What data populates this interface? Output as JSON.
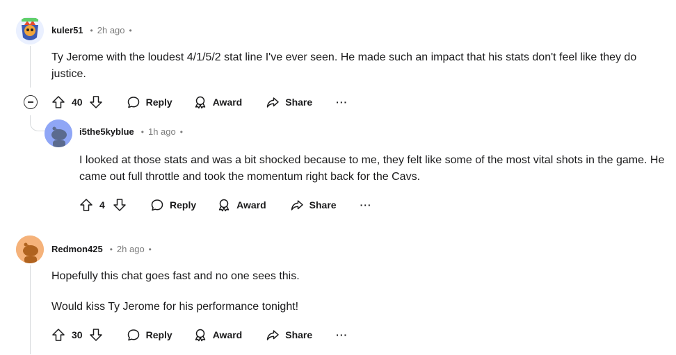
{
  "comments": [
    {
      "author": "kuler51",
      "time": "2h ago",
      "body": [
        "Ty Jerome with the loudest 4/1/5/2 stat line I've ever seen. He made such an impact that his stats don't feel like they do justice."
      ],
      "votes": "40",
      "avatar_badge": "Finish-a-robot"
    },
    {
      "author": "i5the5kyblue",
      "time": "1h ago",
      "body": [
        "I looked at those stats and was a bit shocked because to me, they felt like some of the most vital shots in the game. He came out full throttle and took the momentum right back for the Cavs."
      ],
      "votes": "4"
    },
    {
      "author": "Redmon425",
      "time": "2h ago",
      "body": [
        "Hopefully this chat goes fast and no one sees this.",
        "Would kiss Ty Jerome for his performance tonight!"
      ],
      "votes": "30"
    }
  ],
  "labels": {
    "reply": "Reply",
    "award": "Award",
    "share": "Share",
    "more": "···",
    "separator": "•"
  },
  "colors": {
    "default_avatar_blue": "#8fa6f6",
    "default_avatar_orange": "#f5b27a",
    "thread_line": "#d7dadc"
  }
}
